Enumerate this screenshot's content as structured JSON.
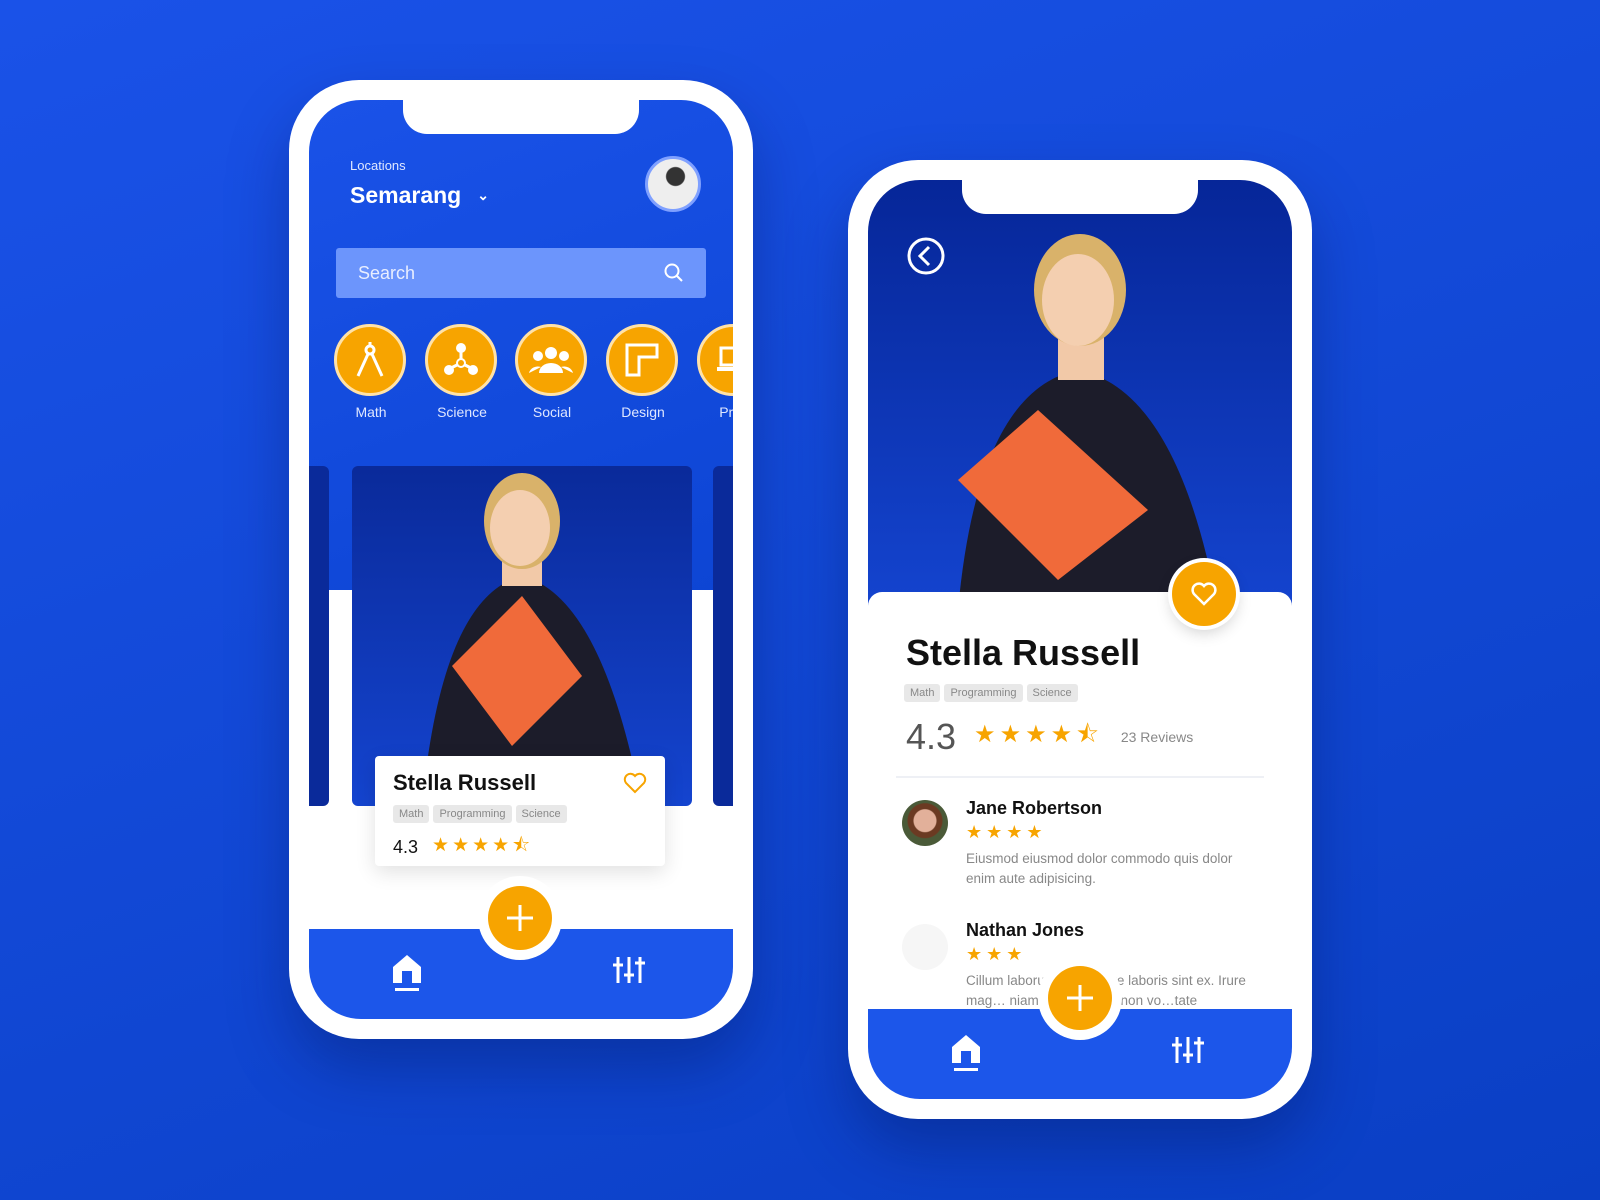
{
  "home": {
    "location_label": "Locations",
    "location_value": "Semarang",
    "search_placeholder": "Search",
    "categories": [
      {
        "label": "Math",
        "icon": "compass-icon"
      },
      {
        "label": "Science",
        "icon": "molecule-icon"
      },
      {
        "label": "Social",
        "icon": "group-icon"
      },
      {
        "label": "Design",
        "icon": "ruler-icon"
      },
      {
        "label": "Prog",
        "icon": "laptop-icon"
      }
    ],
    "card": {
      "name": "Stella Russell",
      "tags": [
        "Math",
        "Programming",
        "Science"
      ],
      "rating": "4.3",
      "stars": 4.5
    }
  },
  "detail": {
    "name": "Stella Russell",
    "tags": [
      "Math",
      "Programming",
      "Science"
    ],
    "rating": "4.3",
    "stars": 4.5,
    "reviews_count": "23 Reviews",
    "reviews": [
      {
        "name": "Jane Robertson",
        "stars": 4,
        "text": "Eiusmod eiusmod dolor commodo quis dolor enim aute adipisicing."
      },
      {
        "name": "Nathan Jones",
        "stars": 3,
        "text": "Cillum laboru… ea sit aute laboris sint ex. Irure mag… niam ipsum. Ex ut non vo…tate"
      }
    ]
  },
  "colors": {
    "primary": "#1c56ea",
    "accent": "#f7a400",
    "dark": "#0a2a9a"
  }
}
